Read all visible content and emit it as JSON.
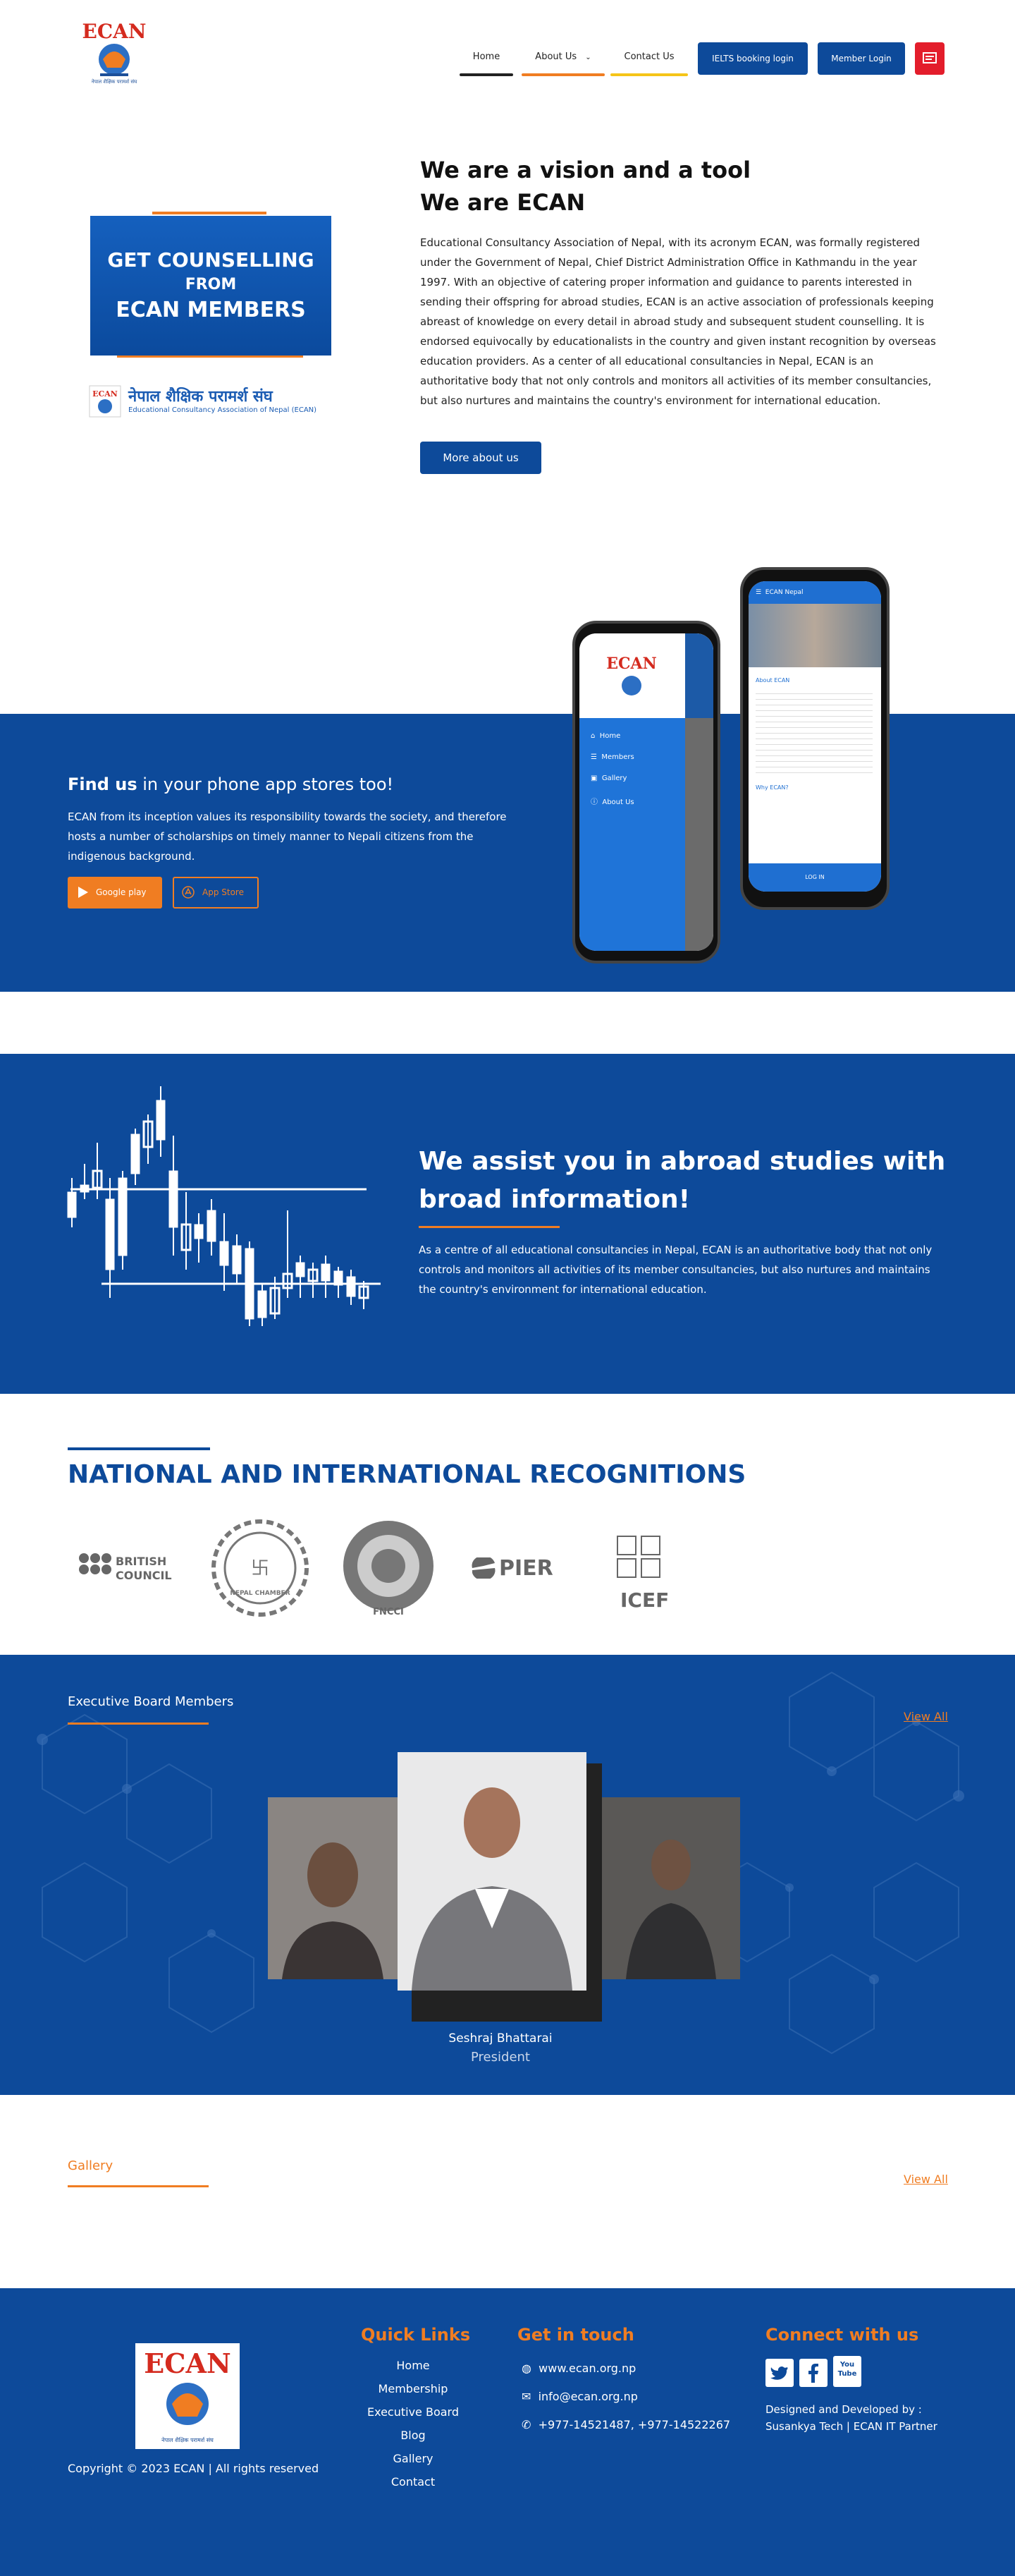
{
  "header": {
    "logo_text": "ECAN",
    "logo_subtitle": "नेपाल शैक्षिक परामर्श संघ",
    "nav": [
      "Home",
      "About Us",
      "Contact Us"
    ],
    "nav_colors": [
      "#222222",
      "#f07d22",
      "#f5c518"
    ],
    "buttons": [
      "IELTS booking login",
      "Member Login"
    ],
    "icon": "newspaper-icon"
  },
  "about": {
    "banner_line1": "GET COUNSELLING",
    "banner_line2": "FROM",
    "banner_line3": "ECAN MEMBERS",
    "banner_logo_np": "नेपाल शैक्षिक परामर्श संघ",
    "banner_logo_en": "Educational Consultancy Association of Nepal (ECAN)",
    "title_line1": "We are a vision and a tool",
    "title_line2": "We are ECAN",
    "paragraph": "Educational Consultancy Association of Nepal, with its acronym ECAN, was formally registered under the Government of Nepal, Chief District Administration Office in Kathmandu in the year 1997. With an objective of catering proper information and guidance to parents interested in sending their offspring for abroad studies, ECAN is an active association of professionals keeping abreast of knowledge on every detail in abroad study and subsequent student counselling. It is endorsed equivocally by educationalists in the country and given instant recognition by overseas education providers. As a center of all educational consultancies in Nepal, ECAN is an authoritative body that not only controls and monitors all activities of its member consultancies, but also nurtures and maintains the country's environment for international education.",
    "button": "More about us"
  },
  "app": {
    "title_bold": "Find us",
    "title_rest": " in your phone app stores too!",
    "text": "ECAN from its inception values its responsibility towards the society, and therefore hosts a number of scholarships on timely manner to Nepali citizens from the indigenous background.",
    "google_play": "Google play",
    "app_store": "App Store",
    "phone_menu": [
      "Home",
      "Members",
      "Gallery",
      "About Us"
    ],
    "phone2_header": "ECAN Nepal",
    "phone2_about": "About ECAN",
    "phone2_why": "Why ECAN?",
    "phone2_login": "LOG IN"
  },
  "assist": {
    "title": "We assist you in abroad studies with broad information!",
    "text": "As a centre of all educational consultancies in Nepal, ECAN is an authoritative body that not only controls and monitors all activities of its member consultancies, but also nurtures and maintains the country's environment for international education."
  },
  "recognitions": {
    "title": "NATIONAL AND INTERNATIONAL RECOGNITIONS",
    "logos": [
      "BRITISH COUNCIL",
      "NEPAL CHAMBER",
      "FNCCI",
      "PIER",
      "ICEF"
    ]
  },
  "board": {
    "label": "Executive Board Members",
    "view_all": "View All",
    "member_name": "Seshraj Bhattarai",
    "member_role": "President"
  },
  "gallery": {
    "label": "Gallery",
    "view_all": "View All"
  },
  "footer": {
    "logo_text": "ECAN",
    "logo_subtitle": "नेपाल शैक्षिक परामर्श संघ",
    "copyright": "Copyright © 2023 ECAN | All rights reserved",
    "quick_links_title": "Quick Links",
    "quick_links": [
      "Home",
      "Membership",
      "Executive Board",
      "Blog",
      "Gallery",
      "Contact"
    ],
    "touch_title": "Get in touch",
    "website": "www.ecan.org.np",
    "email": "info@ecan.org.np",
    "phone": "+977-14521487, +977-14522267",
    "connect_title": "Connect with us",
    "social": [
      "twitter-icon",
      "facebook-icon",
      "youtube-icon"
    ],
    "youtube_label": "You Tube",
    "designed_by_1": "Designed and Developed by :",
    "designed_by_2": "Susankya Tech | ECAN IT Partner"
  },
  "colors": {
    "primary_blue": "#0d4a9a",
    "accent_orange": "#f07d22",
    "accent_red": "#e31d2b"
  }
}
